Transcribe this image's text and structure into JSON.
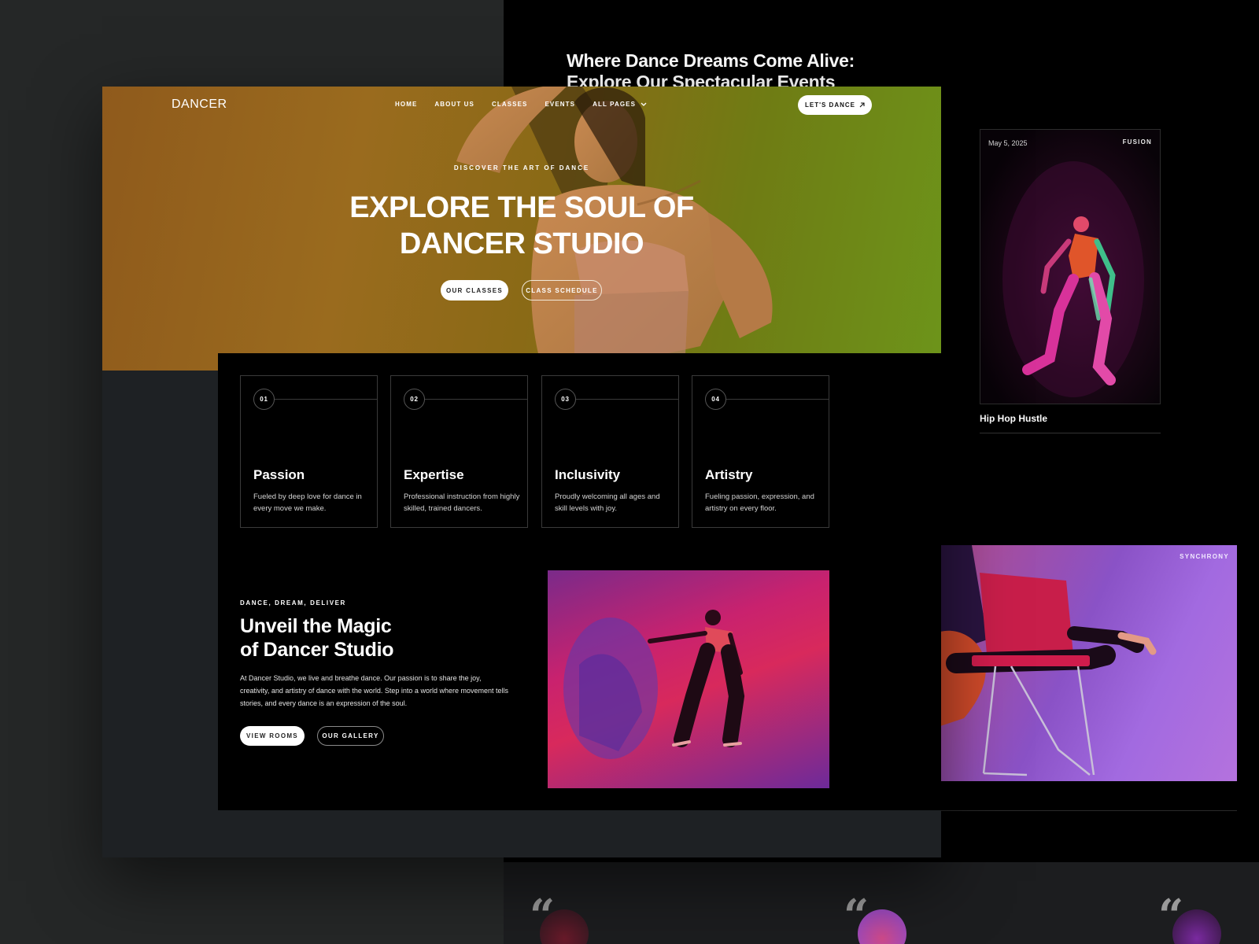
{
  "events_page": {
    "heading": "Where Dance Dreams Come Alive: Explore Our Spectacular Events",
    "card": {
      "date": "May 5, 2025",
      "tag": "FUSION",
      "title": "Hip Hop Hustle"
    },
    "second_card": {
      "tag": "SYNCHRONY"
    },
    "quote_glyph": "“"
  },
  "nav": {
    "logo": "DANCER",
    "links": [
      "HOME",
      "ABOUT US",
      "CLASSES",
      "EVENTS",
      "ALL PAGES"
    ],
    "cta": "LET'S DANCE"
  },
  "hero": {
    "eyebrow": "DISCOVER THE ART OF DANCE",
    "title_line1": "EXPLORE THE SOUL OF",
    "title_line2": "DANCER STUDIO",
    "btn_primary": "OUR CLASSES",
    "btn_secondary": "CLASS SCHEDULE"
  },
  "features": [
    {
      "num": "01",
      "title": "Passion",
      "desc": "Fueled by deep love for dance in every move we make."
    },
    {
      "num": "02",
      "title": "Expertise",
      "desc": "Professional instruction from highly skilled, trained dancers."
    },
    {
      "num": "03",
      "title": "Inclusivity",
      "desc": "Proudly welcoming all ages and skill levels with joy."
    },
    {
      "num": "04",
      "title": "Artistry",
      "desc": "Fueling passion, expression, and artistry on every floor."
    }
  ],
  "about": {
    "eyebrow": "DANCE, DREAM, DELIVER",
    "title_line1": "Unveil the Magic",
    "title_line2": "of Dancer Studio",
    "body": "At Dancer Studio, we live and breathe dance. Our passion is to share the joy, creativity, and artistry of dance with the world. Step into a world where movement tells stories, and every dance is an expression of the soul.",
    "btn_primary": "VIEW ROOMS",
    "btn_secondary": "OUR GALLERY"
  }
}
